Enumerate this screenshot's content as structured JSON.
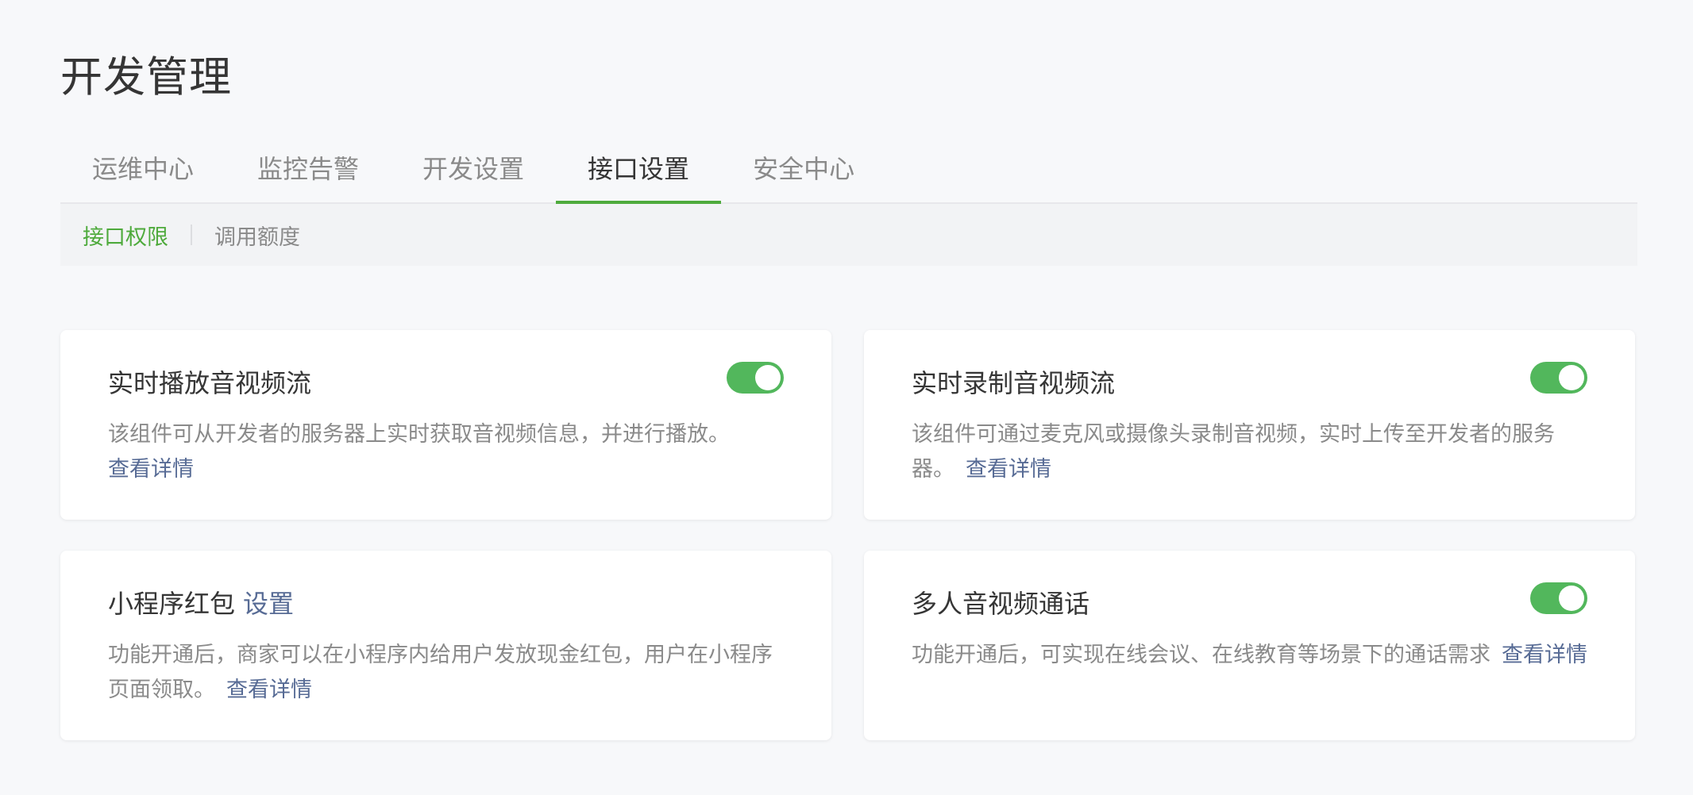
{
  "header": {
    "title": "开发管理"
  },
  "tabs": [
    {
      "label": "运维中心",
      "active": false
    },
    {
      "label": "监控告警",
      "active": false
    },
    {
      "label": "开发设置",
      "active": false
    },
    {
      "label": "接口设置",
      "active": true
    },
    {
      "label": "安全中心",
      "active": false
    }
  ],
  "subtabs": [
    {
      "label": "接口权限",
      "active": true
    },
    {
      "label": "调用额度",
      "active": false
    }
  ],
  "cards": [
    {
      "title": "实时播放音视频流",
      "description": "该组件可从开发者的服务器上实时获取音视频信息，并进行播放。",
      "link": "查看详情",
      "toggle_on": true
    },
    {
      "title": "实时录制音视频流",
      "description": "该组件可通过麦克风或摄像头录制音视频，实时上传至开发者的服务器。",
      "link": "查看详情",
      "toggle_on": true
    },
    {
      "title": "小程序红包",
      "title_link": "设置",
      "description": "功能开通后，商家可以在小程序内给用户发放现金红包，用户在小程序页面领取。",
      "link": "查看详情"
    },
    {
      "title": "多人音视频通话",
      "description": "功能开通后，可实现在线会议、在线教育等场景下的通话需求",
      "link": "查看详情",
      "toggle_on": true
    }
  ],
  "colors": {
    "accent_green": "#4eaa3c",
    "toggle_green": "#52b75c",
    "link_blue": "#576b95",
    "text_primary": "#353535",
    "text_secondary": "#8a8a8a"
  }
}
